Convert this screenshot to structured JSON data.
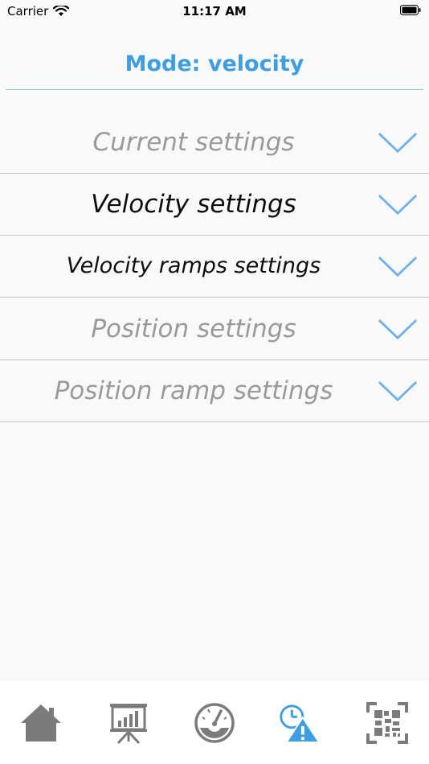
{
  "status_bar": {
    "carrier": "Carrier",
    "time": "11:17 AM",
    "icons": [
      "wifi-icon",
      "battery-icon"
    ]
  },
  "header": {
    "title": "Mode: velocity"
  },
  "sections": [
    {
      "label": "Current settings",
      "enabled": false,
      "icon": "chevron-down-icon"
    },
    {
      "label": "Velocity settings",
      "enabled": true,
      "icon": "chevron-down-icon"
    },
    {
      "label": "Velocity ramps settings",
      "enabled": true,
      "icon": "chevron-down-icon"
    },
    {
      "label": "Position settings",
      "enabled": false,
      "icon": "chevron-down-icon"
    },
    {
      "label": "Position ramp settings",
      "enabled": false,
      "icon": "chevron-down-icon"
    }
  ],
  "tab_bar": {
    "tabs": [
      {
        "icon": "home-icon",
        "selected": false
      },
      {
        "icon": "presentation-chart-icon",
        "selected": false
      },
      {
        "icon": "speedometer-icon",
        "selected": false
      },
      {
        "icon": "clock-warning-icon",
        "selected": true
      },
      {
        "icon": "qr-code-icon",
        "selected": false
      }
    ]
  },
  "colors": {
    "accent": "#3f9ee0",
    "chevron": "#6aaee8",
    "disabled_text": "#9a9a9a",
    "tab_icon": "#7b7b7b",
    "divider": "#c4c4c4"
  }
}
